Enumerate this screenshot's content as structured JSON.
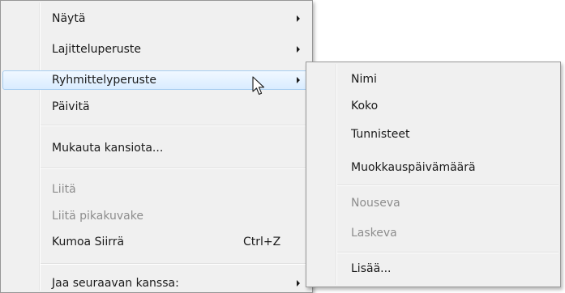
{
  "context_menu": {
    "items": [
      {
        "label": "Näytä"
      },
      {
        "label": "Lajitteluperuste"
      },
      {
        "label": "Ryhmittelyperuste"
      },
      {
        "label": "Päivitä"
      },
      {
        "label": "Mukauta kansiota..."
      },
      {
        "label": "Liitä"
      },
      {
        "label": "Liitä pikakuvake"
      },
      {
        "label": "Kumoa Siirrä",
        "shortcut": "Ctrl+Z"
      },
      {
        "label": "Jaa seuraavan kanssa:"
      }
    ]
  },
  "submenu": {
    "items": [
      {
        "label": "Nimi"
      },
      {
        "label": "Koko"
      },
      {
        "label": "Tunnisteet"
      },
      {
        "label": "Muokkauspäivämäärä"
      },
      {
        "label": "Nouseva"
      },
      {
        "label": "Laskeva"
      },
      {
        "label": "Lisää..."
      }
    ]
  },
  "icons": {
    "submenu_arrow": "chevron-right-icon",
    "pointer": "mouse-pointer-icon"
  },
  "colors": {
    "menu_background": "#f0f0f0",
    "hover_border": "#a7cdf0",
    "disabled_text": "#8d8d8d"
  }
}
